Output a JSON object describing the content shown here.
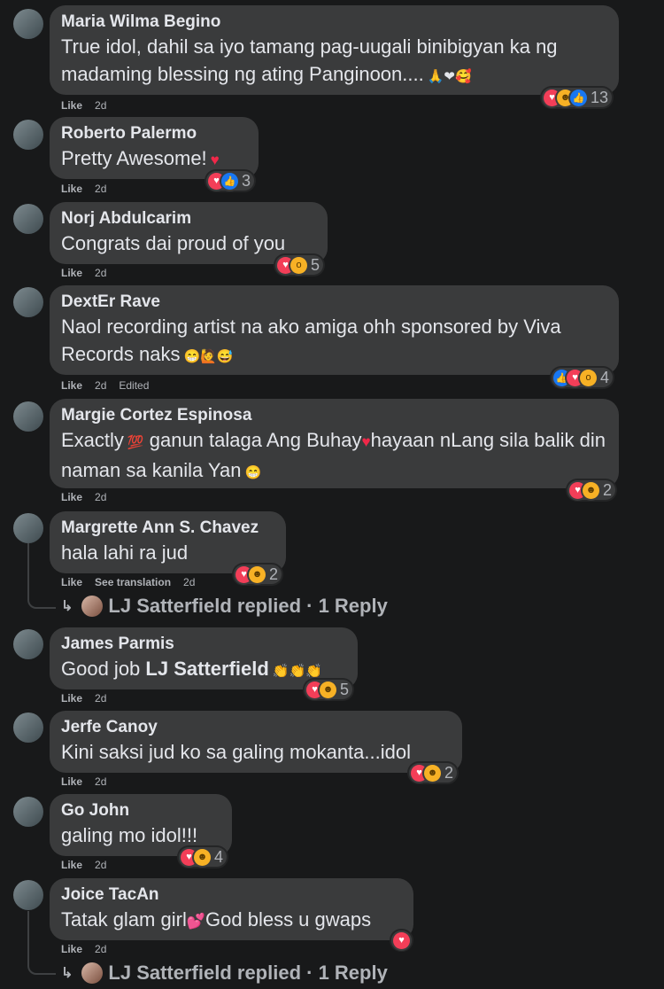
{
  "comments": [
    {
      "author": "Maria Wilma Begino",
      "text": "True idol, dahil sa iyo tamang pag-uugali binibigyan ka ng madaming blessing ng ating Panginoon....",
      "emoji": "🙏❤🥰",
      "like": "Like",
      "time": "2d",
      "reactions": [
        "love-icon",
        "haha-icon",
        "like-icon"
      ],
      "count": "13"
    },
    {
      "author": "Roberto Palermo",
      "text": "Pretty Awesome!",
      "emoji": "♥",
      "like": "Like",
      "time": "2d",
      "reactions": [
        "love-icon",
        "like-icon"
      ],
      "count": "3"
    },
    {
      "author": "Norj Abdulcarim",
      "text": "Congrats dai proud of you",
      "like": "Like",
      "time": "2d",
      "reactions": [
        "love-icon",
        "wow-icon"
      ],
      "count": "5"
    },
    {
      "author": "DextEr Rave",
      "text": "Naol recording artist na ako amiga ohh sponsored by Viva Records naks",
      "emoji": "😁🙋😅",
      "like": "Like",
      "time": "2d",
      "edited": "Edited",
      "reactions": [
        "like-icon",
        "love-icon",
        "wow-icon"
      ],
      "count": "4"
    },
    {
      "author": "Margie Cortez Espinosa",
      "text_a": "Exactly",
      "emoji_a": "💯",
      "text_b": "ganun talaga Ang Buhay",
      "emoji_b": "♥",
      "text_c": "hayaan nLang sila balik din naman sa kanila Yan",
      "emoji_c": "😁",
      "like": "Like",
      "time": "2d",
      "reactions": [
        "love-icon",
        "haha-icon"
      ],
      "count": "2"
    },
    {
      "author": "Margrette Ann S. Chavez",
      "text": "hala lahi ra jud",
      "like": "Like",
      "see_translation": "See translation",
      "time": "2d",
      "reactions": [
        "love-icon",
        "haha-icon"
      ],
      "count": "2",
      "reply_label": "LJ Satterfield replied · 1 Reply"
    },
    {
      "author": "James Parmis",
      "text": "Good job",
      "mention": "LJ Satterfield",
      "emoji": "👏👏👏",
      "like": "Like",
      "time": "2d",
      "reactions": [
        "love-icon",
        "haha-icon"
      ],
      "count": "5"
    },
    {
      "author": "Jerfe Canoy",
      "text": "Kini saksi jud ko sa galing mokanta...idol",
      "like": "Like",
      "time": "2d",
      "reactions": [
        "love-icon",
        "haha-icon"
      ],
      "count": "2"
    },
    {
      "author": "Go John",
      "text": "galing mo idol!!!",
      "like": "Like",
      "time": "2d",
      "reactions": [
        "love-icon",
        "haha-icon"
      ],
      "count": "4"
    },
    {
      "author": "Joice TacAn",
      "text_a": "Tatak glam girl",
      "emoji_a": "💕",
      "text_b": "God bless u gwaps",
      "like": "Like",
      "time": "2d",
      "reactions": [
        "love-icon"
      ],
      "reply_label": "LJ Satterfield replied · 1 Reply"
    }
  ],
  "colors": {
    "background": "#18191a",
    "bubble": "#3a3b3c",
    "text": "#e4e6eb",
    "secondary": "#b0b3b8",
    "love": "#f33e58",
    "like": "#1877f2",
    "haha": "#f7b125"
  }
}
